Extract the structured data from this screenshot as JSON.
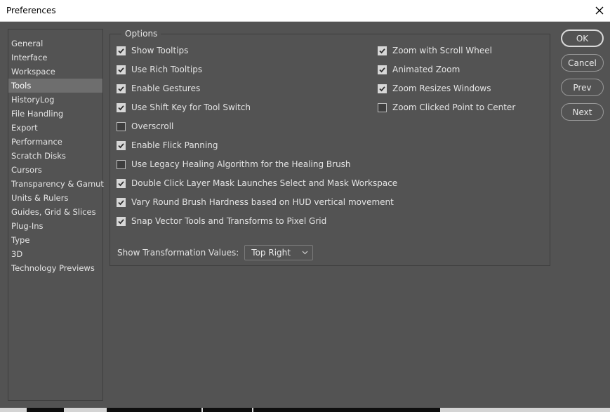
{
  "window": {
    "title": "Preferences",
    "close_icon": "close-icon"
  },
  "sidebar": {
    "items": [
      {
        "label": "General",
        "selected": false
      },
      {
        "label": "Interface",
        "selected": false
      },
      {
        "label": "Workspace",
        "selected": false
      },
      {
        "label": "Tools",
        "selected": true
      },
      {
        "label": "HistoryLog",
        "selected": false
      },
      {
        "label": "File Handling",
        "selected": false
      },
      {
        "label": "Export",
        "selected": false
      },
      {
        "label": "Performance",
        "selected": false
      },
      {
        "label": "Scratch Disks",
        "selected": false
      },
      {
        "label": "Cursors",
        "selected": false
      },
      {
        "label": "Transparency & Gamut",
        "selected": false
      },
      {
        "label": "Units & Rulers",
        "selected": false
      },
      {
        "label": "Guides, Grid & Slices",
        "selected": false
      },
      {
        "label": "Plug-Ins",
        "selected": false
      },
      {
        "label": "Type",
        "selected": false
      },
      {
        "label": "3D",
        "selected": false
      },
      {
        "label": "Technology Previews",
        "selected": false
      }
    ]
  },
  "options": {
    "legend": "Options",
    "left_column": [
      {
        "label": "Show Tooltips",
        "checked": true
      },
      {
        "label": "Use Rich Tooltips",
        "checked": true
      },
      {
        "label": "Enable Gestures",
        "checked": true
      },
      {
        "label": "Use Shift Key for Tool Switch",
        "checked": true
      },
      {
        "label": "Overscroll",
        "checked": false
      },
      {
        "label": "Enable Flick Panning",
        "checked": true
      },
      {
        "label": "Use Legacy Healing Algorithm for the Healing Brush",
        "checked": false
      },
      {
        "label": "Double Click Layer Mask Launches Select and Mask Workspace",
        "checked": true
      },
      {
        "label": "Vary Round Brush Hardness based on HUD vertical movement",
        "checked": true
      },
      {
        "label": "Snap Vector Tools and Transforms to Pixel Grid",
        "checked": true
      }
    ],
    "right_column": [
      {
        "label": "Zoom with Scroll Wheel",
        "checked": true
      },
      {
        "label": "Animated Zoom",
        "checked": true
      },
      {
        "label": "Zoom Resizes Windows",
        "checked": true
      },
      {
        "label": "Zoom Clicked Point to Center",
        "checked": false
      }
    ],
    "transformation": {
      "label": "Show Transformation Values:",
      "value": "Top Right"
    }
  },
  "buttons": {
    "ok": "OK",
    "cancel": "Cancel",
    "prev": "Prev",
    "next": "Next"
  },
  "colors": {
    "panel_bg": "#535353",
    "selected_bg": "#6e6e6e",
    "text": "#e4e4e4"
  }
}
